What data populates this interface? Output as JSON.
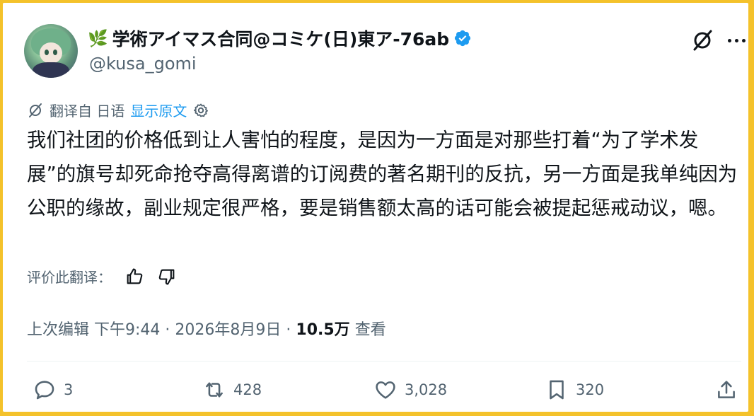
{
  "author": {
    "name_emoji": "🌿",
    "display_name": "学術アイマス合同@コミケ(日)東ア-76ab",
    "handle": "@kusa_gomi",
    "verified_color": "#1d9bf0"
  },
  "translation": {
    "translated_from": "翻译自 日语",
    "show_original": "显示原文"
  },
  "tweet": {
    "text": "我们社团的价格低到让人害怕的程度，是因为一方面是对那些打着“为了学术发展”的旗号却死命抢夺高得离谱的订阅费的著名期刊的反抗，另一方面是我单纯因为公职的缘故，副业规定很严格，要是销售额太高的话可能会被提起惩戒动议，嗯。"
  },
  "rating": {
    "label": "评价此翻译："
  },
  "meta": {
    "edited": "上次编辑",
    "time": "下午9:44",
    "separator1": "·",
    "date": "2026年8月9日",
    "separator2": "·",
    "views_count": "10.5万",
    "views_label": "查看"
  },
  "actions": {
    "replies": "3",
    "retweets": "428",
    "likes": "3,028",
    "bookmarks": "320"
  },
  "icons": [
    "grok-icon",
    "more-icon",
    "translate-icon",
    "gear-icon",
    "thumbs-up-icon",
    "thumbs-down-icon",
    "reply-icon",
    "retweet-icon",
    "like-icon",
    "bookmark-icon",
    "share-icon"
  ],
  "colors": {
    "accent": "#1d9bf0",
    "text": "#0f1419",
    "secondary": "#536471",
    "frame": "#f4c22b"
  }
}
